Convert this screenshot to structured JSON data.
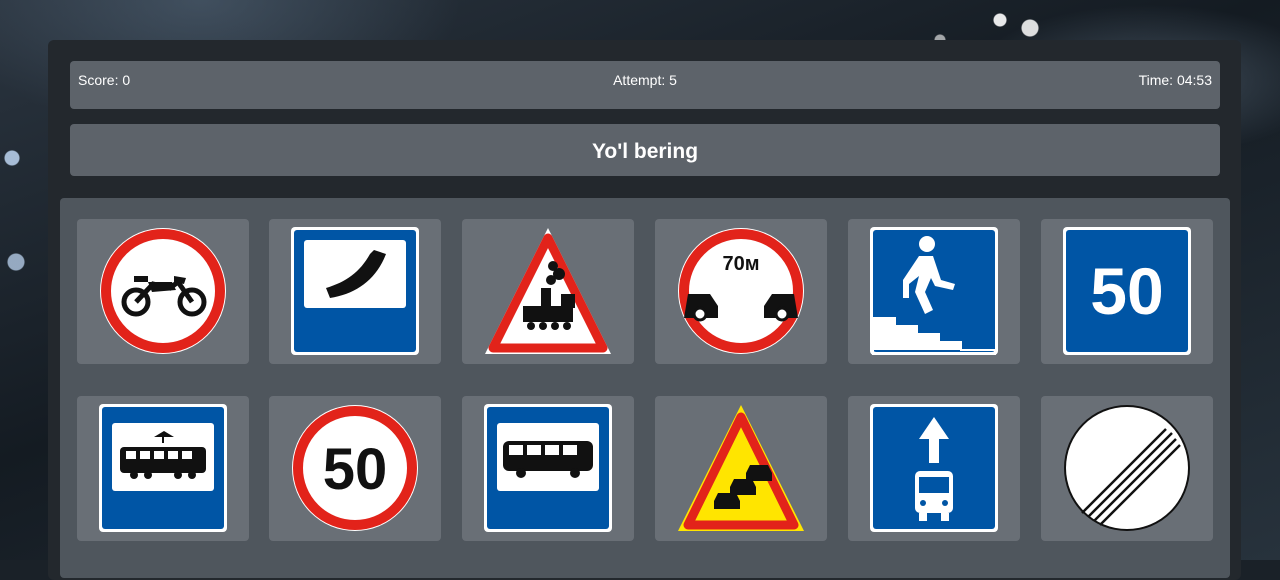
{
  "header": {
    "score_text": "Score: 0",
    "attempt_text": "Attempt: 5",
    "time_text": "Time: 04:53"
  },
  "question": {
    "text": "Yo'l bering"
  },
  "signs": [
    {
      "name": "no-motorcycles-sign"
    },
    {
      "name": "telephone-sign"
    },
    {
      "name": "unguarded-railway-crossing-sign"
    },
    {
      "name": "minimum-distance-sign",
      "label": "70м"
    },
    {
      "name": "underground-pedestrian-crossing-sign"
    },
    {
      "name": "recommended-speed-sign",
      "label": "50"
    },
    {
      "name": "tram-stop-sign"
    },
    {
      "name": "speed-limit-sign",
      "label": "50"
    },
    {
      "name": "bus-stop-sign"
    },
    {
      "name": "traffic-jam-sign"
    },
    {
      "name": "bus-lane-sign"
    },
    {
      "name": "end-of-all-restrictions-sign"
    }
  ],
  "colors": {
    "sign_red": "#e2231a",
    "sign_blue": "#0055a5",
    "sign_yellow": "#ffe500"
  }
}
